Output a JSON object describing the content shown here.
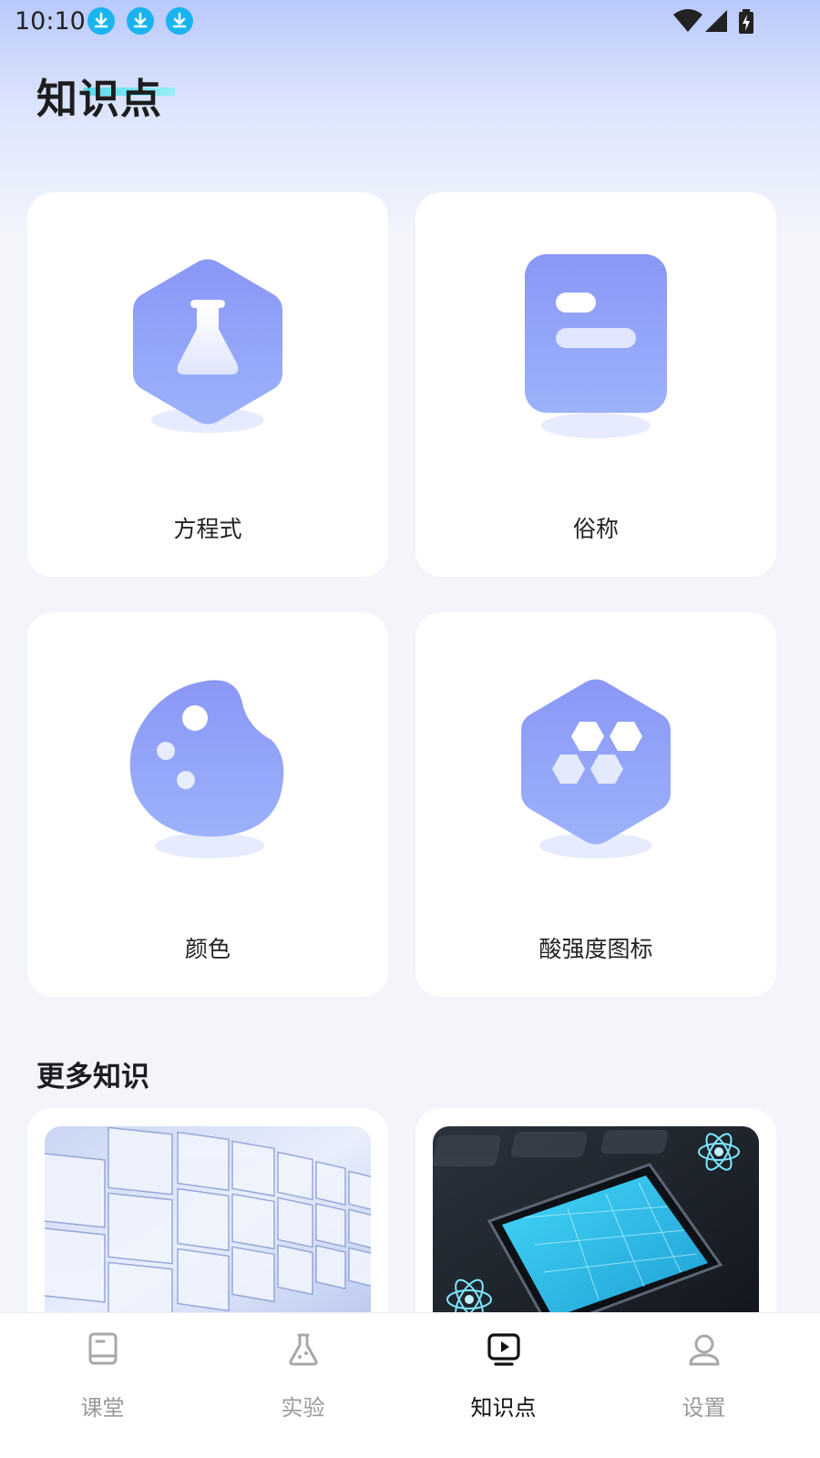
{
  "status_bar": {
    "time": "10:10",
    "notification_icons": [
      "download-icon",
      "download-icon",
      "download-icon"
    ],
    "right_icons": [
      "wifi-icon",
      "signal-icon",
      "battery-charging-icon"
    ]
  },
  "page": {
    "title": "知识点"
  },
  "categories": [
    {
      "label": "方程式",
      "icon": "flask-icon"
    },
    {
      "label": "俗称",
      "icon": "document-icon"
    },
    {
      "label": "颜色",
      "icon": "palette-icon"
    },
    {
      "label": "酸强度图标",
      "icon": "hexagon-molecule-icon"
    }
  ],
  "more": {
    "title": "更多知识",
    "items": [
      {
        "image": "periodic-table-image"
      },
      {
        "image": "tablet-atom-image"
      }
    ]
  },
  "bottom_nav": {
    "items": [
      {
        "label": "课堂",
        "icon": "book-icon"
      },
      {
        "label": "实验",
        "icon": "flask-icon"
      },
      {
        "label": "知识点",
        "icon": "play-screen-icon"
      },
      {
        "label": "设置",
        "icon": "user-icon"
      }
    ],
    "active_index": 2
  },
  "colors": {
    "accent": "#8e9cf5",
    "accent_light": "#a8b8ff",
    "background": "#f3f5fb",
    "title_accent": "#3cd9e8"
  }
}
